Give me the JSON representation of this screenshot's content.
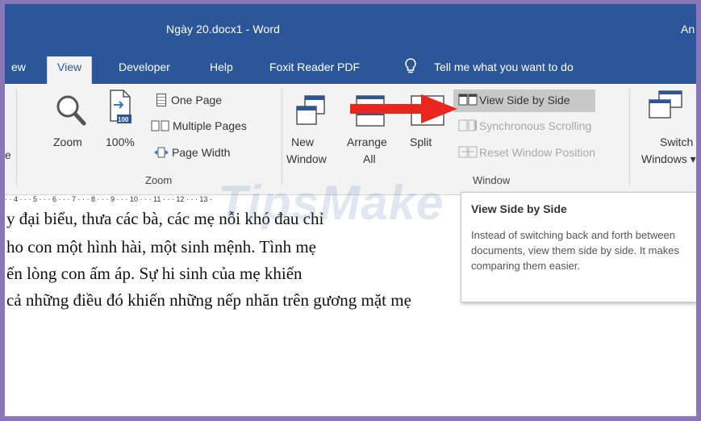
{
  "window": {
    "title": "Ngày 20.docx1  -  Word",
    "user": "An"
  },
  "tabs": [
    "ew",
    "View",
    "Developer",
    "Help",
    "Foxit Reader PDF"
  ],
  "tell_me": "Tell me what you want to do",
  "ribbon": {
    "left_cut": "e",
    "zoom_group": {
      "label": "Zoom",
      "zoom": "Zoom",
      "hundred": "100%",
      "hundred_badge": "100",
      "one_page": "One Page",
      "multiple_pages": "Multiple Pages",
      "page_width": "Page Width"
    },
    "window_group": {
      "label": "Window",
      "new_window": [
        "New",
        "Window"
      ],
      "arrange_all": [
        "Arrange",
        "All"
      ],
      "split": "Split",
      "view_side_by_side": "View Side by Side",
      "synchronous_scrolling": "Synchronous Scrolling",
      "reset_window_position": "Reset Window Position",
      "switch_windows": [
        "Switch",
        "Windows ▾"
      ]
    }
  },
  "ruler": "· · 4 · · · 5 · · · 6 · · · 7 · · · 8 · · · 9 · · · 10 · · · 11 · · · 12 · · · 13 ·",
  "document": {
    "lines": [
      "y đại biểu, thưa các bà, các mẹ nỗi khó đau chỉ",
      "ho con một hình hài, một sinh mệnh. Tình mẹ",
      "ến lòng con ấm áp. Sự hi sinh của mẹ khiến",
      "cả những điều đó khiến những nếp nhăn trên gương mặt mẹ"
    ]
  },
  "watermark": "TipsMake",
  "tooltip": {
    "title": "View Side by Side",
    "body": "Instead of switching back and forth between documents, view them side by side. It makes comparing them easier."
  },
  "colors": {
    "title_bar": "#2b579a",
    "arrow": "#e8261e",
    "frame": "#8878b8"
  }
}
